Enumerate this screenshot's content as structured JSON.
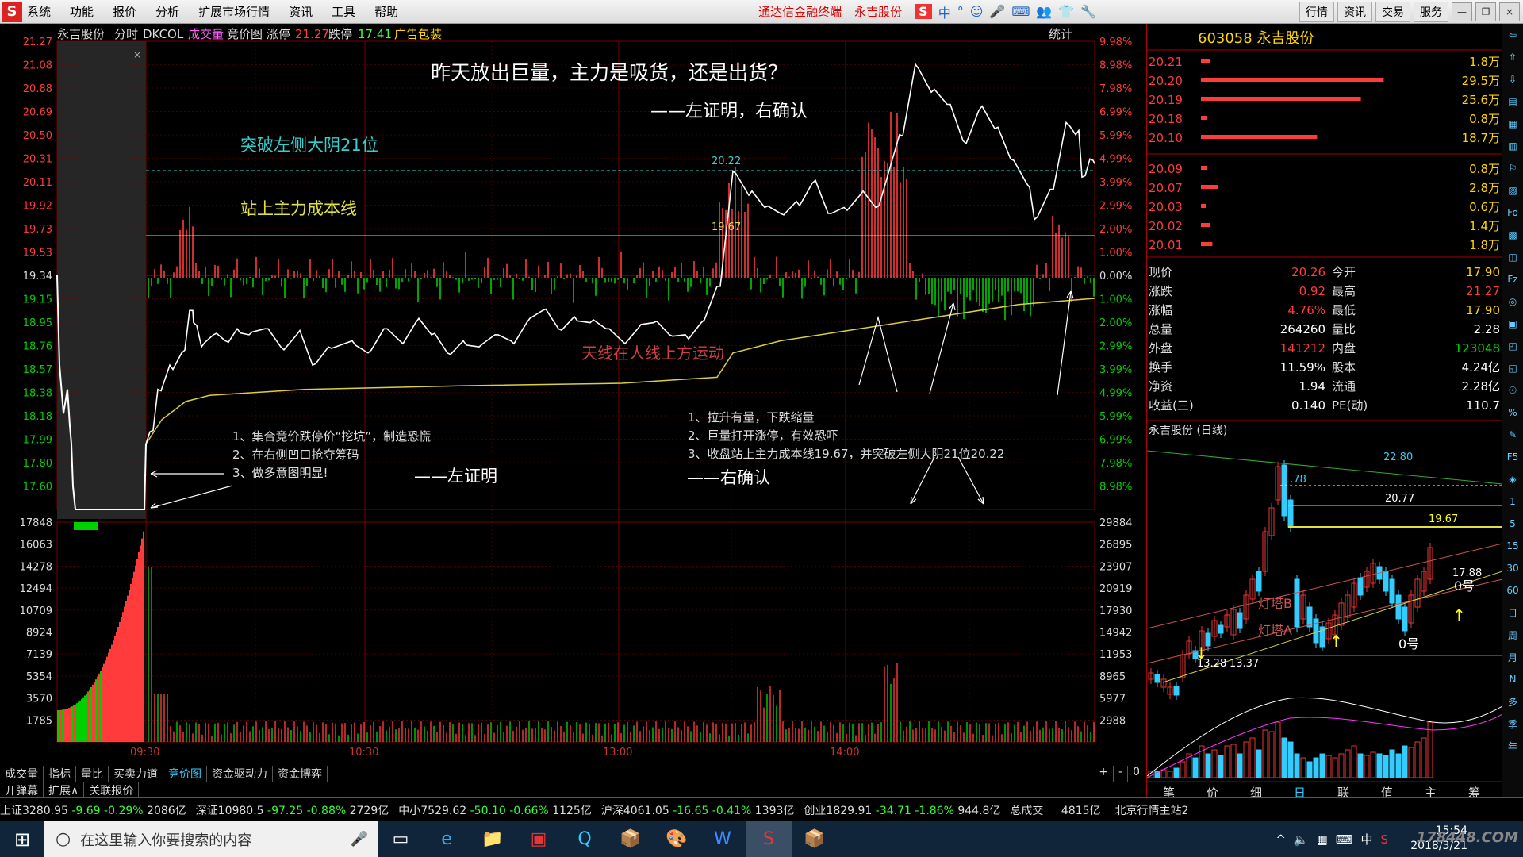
{
  "menubar": {
    "logo": "S",
    "items": [
      "系统",
      "功能",
      "报价",
      "分析",
      "扩展市场行情",
      "资讯",
      "工具",
      "帮助"
    ],
    "promo1": "通达信金融终端",
    "promo2": "永吉股份",
    "tools": [
      "S",
      "中",
      "°",
      "☺",
      "🎤",
      "⌨",
      "👥",
      "👕",
      "🔧"
    ],
    "right": [
      "行情",
      "资讯",
      "交易",
      "服务"
    ],
    "win": [
      "—",
      "❐",
      "×"
    ]
  },
  "header": {
    "name": "永吉股份",
    "mode": "分时",
    "dkcol": "DKCOL",
    "vol": "成交量",
    "auction": "竞价图",
    "up_label": "涨停",
    "up_val": "21.27",
    "down_label": "跌停",
    "down_val": "17.41",
    "ad": "广告包装",
    "stat": "统计"
  },
  "price_axis": [
    "21.27",
    "21.08",
    "20.88",
    "20.69",
    "20.50",
    "20.31",
    "20.11",
    "19.92",
    "19.73",
    "19.53",
    "19.34",
    "19.15",
    "18.95",
    "18.76",
    "18.57",
    "18.38",
    "18.18",
    "17.99",
    "17.80",
    "17.60"
  ],
  "pct_axis": [
    "9.98%",
    "8.98%",
    "7.98%",
    "6.99%",
    "5.99%",
    "4.99%",
    "3.99%",
    "2.99%",
    "2.00%",
    "1.00%",
    "0.00%",
    "1.00%",
    "2.00%",
    "2.99%",
    "3.99%",
    "4.99%",
    "5.99%",
    "6.99%",
    "7.98%",
    "8.98%"
  ],
  "vol_left": [
    "17848",
    "16063",
    "14278",
    "12494",
    "10709",
    "8924",
    "7139",
    "5354",
    "3570",
    "1785"
  ],
  "vol_right": [
    "29884",
    "26895",
    "23907",
    "20919",
    "17930",
    "14942",
    "11953",
    "8965",
    "5977",
    "2988"
  ],
  "time_axis": [
    "09:30",
    "10:30",
    "13:00",
    "14:00"
  ],
  "annot": {
    "title": "昨天放出巨量，主力是吸货，还是出货？",
    "left_right": "——左证明，右确认",
    "break": "突破左侧大阴21位",
    "cost": "站上主力成本线",
    "lv1": "20.22",
    "lv2": "19.67",
    "sky": "天线在人线上方运动",
    "l1": "1、集合竞价跌停价“挖坑”，制造恐慌",
    "l2": "2、在右侧凹口抢夺筹码",
    "l3": "3、做多意图明显!",
    "lproof": "——左证明",
    "r1": "1、拉升有量，下跌缩量",
    "r2": "2、巨量打开涨停，有效恐吓",
    "r3": "3、收盘站上主力成本线19.67，并突破左侧大阴21位20.22",
    "rconf": "——右确认"
  },
  "tabs1": [
    "成交量",
    "指标",
    "量比",
    "买卖力道",
    "竞价图",
    "资金驱动力",
    "资金博弈"
  ],
  "tabs2": [
    "开弹幕",
    "扩展∧",
    "关联报价"
  ],
  "tabs_right": [
    "+",
    "-",
    "0"
  ],
  "quote": {
    "title": "603058 永吉股份",
    "asks": [
      {
        "p": "20.21",
        "v": "1.8万",
        "w": 0.05
      },
      {
        "p": "20.20",
        "v": "29.5万",
        "w": 0.96
      },
      {
        "p": "20.19",
        "v": "25.6万",
        "w": 0.84
      },
      {
        "p": "20.18",
        "v": "0.8万",
        "w": 0.03
      },
      {
        "p": "20.10",
        "v": "18.7万",
        "w": 0.61
      }
    ],
    "bids": [
      {
        "p": "20.09",
        "v": "0.8万",
        "w": 0.03
      },
      {
        "p": "20.07",
        "v": "2.8万",
        "w": 0.09
      },
      {
        "p": "20.03",
        "v": "0.6万",
        "w": 0.02
      },
      {
        "p": "20.02",
        "v": "1.4万",
        "w": 0.05
      },
      {
        "p": "20.01",
        "v": "1.8万",
        "w": 0.06
      }
    ],
    "stats": [
      [
        "现价",
        "20.26",
        "今开",
        "17.90"
      ],
      [
        "涨跌",
        "0.92",
        "最高",
        "21.27"
      ],
      [
        "涨幅",
        "4.76%",
        "最低",
        "17.90"
      ],
      [
        "总量",
        "264260",
        "量比",
        "2.28"
      ],
      [
        "外盘",
        "141212",
        "内盘",
        "123048"
      ],
      [
        "换手",
        "11.59%",
        "股本",
        "4.24亿"
      ],
      [
        "净资",
        "1.94",
        "流通",
        "2.28亿"
      ],
      [
        "收益(三)",
        "0.140",
        "PE(动)",
        "110.7"
      ]
    ]
  },
  "kline": {
    "title": "永吉股份 (日线)",
    "l1": "22.80",
    "l2": "1.78",
    "l3": "20.77",
    "l4": "19.67",
    "lA": "灯塔A",
    "lB": "灯塔B",
    "zero1": "0号",
    "zero2": "0号",
    "v1": "17.88",
    "lo1": "13.28",
    "lo2": "13.37"
  },
  "ktabs": [
    "笔",
    "价",
    "细",
    "日",
    "联",
    "值",
    "主",
    "筹"
  ],
  "sidetool": [
    "⇦",
    "⇧",
    "⇩",
    "▤",
    "▦",
    "▥",
    "⚐",
    "▨",
    "Fo",
    "▩",
    "◫",
    "Fz",
    "◎",
    "▣",
    "◰",
    "◱",
    "☉",
    "%",
    "✎",
    "F5",
    "◈",
    "1",
    "5",
    "15",
    "30",
    "60",
    "日",
    "周",
    "月",
    "N",
    "多",
    "季",
    "年"
  ],
  "status": {
    "sh": "上证3280.95",
    "sh_c": "-9.69",
    "sh_p": "-0.29%",
    "sh_v": "2086亿",
    "sz": "深证10980.5",
    "sz_c": "-97.25",
    "sz_p": "-0.88%",
    "sz_v": "2729亿",
    "zx": "中小7529.62",
    "zx_c": "-50.10",
    "zx_p": "-0.66%",
    "zx_v": "1125亿",
    "hs": "沪深4061.05",
    "hs_c": "-16.65",
    "hs_p": "-0.41%",
    "hs_v": "1393亿",
    "cy": "创业1829.91",
    "cy_c": "-34.71",
    "cy_p": "-1.86%",
    "cy_v": "944.8亿",
    "total": "总成交",
    "total_v": "4815亿",
    "server": "北京行情主站2"
  },
  "taskbar": {
    "search": "在这里输入你要搜索的内容",
    "time": "15:54",
    "date": "2018/3/21",
    "ime": "中",
    "wm": "178448.COM",
    "apps": [
      "▭",
      "e",
      "📁",
      "▣",
      "Q",
      "📦",
      "🎨",
      "W",
      "S",
      "📦"
    ]
  },
  "colors": {
    "up": "#ff3b3b",
    "down": "#00d000",
    "price_line": "#ffffff",
    "avg_line": "#d8d040",
    "grid": "#7a0000"
  }
}
